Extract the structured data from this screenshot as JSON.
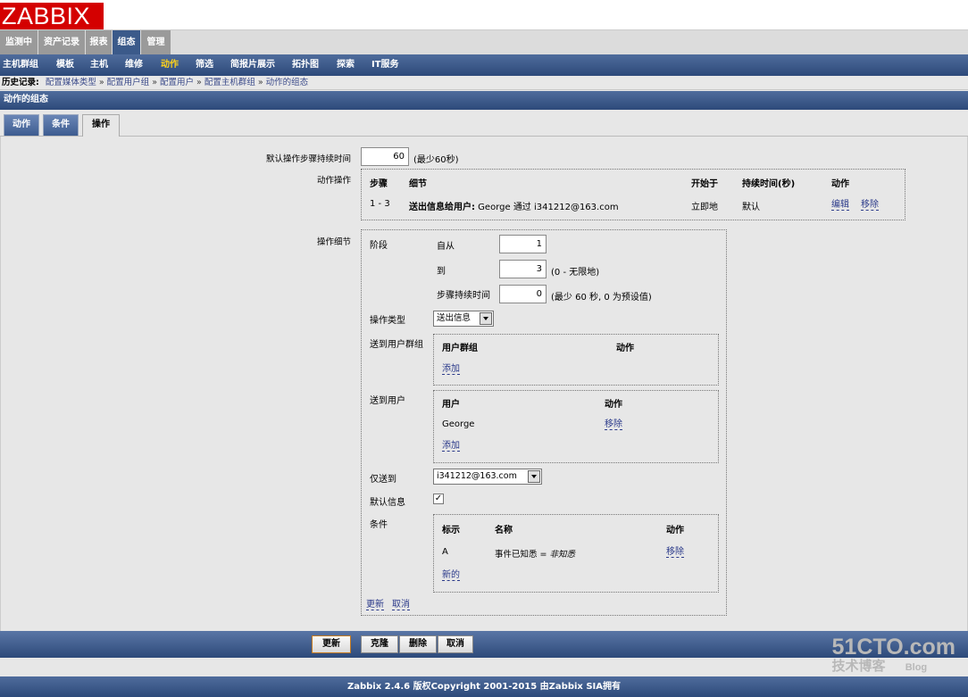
{
  "logo": "ZABBIX",
  "main_menu": [
    "监测中",
    "资产记录",
    "报表",
    "组态",
    "管理"
  ],
  "main_menu_active": "组态",
  "sub_menu": [
    "主机群组",
    "模板",
    "主机",
    "维修",
    "动作",
    "筛选",
    "简报片展示",
    "拓扑图",
    "探索",
    "IT服务"
  ],
  "sub_menu_active": "动作",
  "history": {
    "label": "历史记录:",
    "items": [
      "配置媒体类型",
      "配置用户组",
      "配置用户",
      "配置主机群组",
      "动作的组态"
    ],
    "separator": "»"
  },
  "page_title": "动作的组态",
  "tabs": [
    "动作",
    "条件",
    "操作"
  ],
  "active_tab": "操作",
  "form": {
    "default_step_duration_label": "默认操作步骤持续时间",
    "default_step_duration_value": "60",
    "default_step_duration_hint": "(最少60秒)",
    "operations_label": "动作操作",
    "operations_table": {
      "headers": [
        "步骤",
        "细节",
        "开始于",
        "持续时间(秒)",
        "动作"
      ],
      "rows": [
        {
          "steps": "1 - 3",
          "detail_bold": "送出信息给用户:",
          "detail_rest": " George 通过 i341212@163.com",
          "start": "立即地",
          "duration": "默认",
          "edit": "编辑",
          "remove": "移除"
        }
      ]
    },
    "op_details_label": "操作细节",
    "step_label": "阶段",
    "from_label": "自从",
    "from_value": "1",
    "to_label": "到",
    "to_value": "3",
    "to_hint": "(0 - 无限地)",
    "step_duration_label": "步骤持续时间",
    "step_duration_value": "0",
    "step_duration_hint": "(最少 60 秒, 0 为预设值)",
    "op_type_label": "操作类型",
    "op_type_value": "送出信息",
    "send_groups_label": "送到用户群组",
    "groups_table": {
      "headers": [
        "用户群组",
        "动作"
      ],
      "add": "添加"
    },
    "send_users_label": "送到用户",
    "users_table": {
      "headers": [
        "用户",
        "动作"
      ],
      "rows": [
        {
          "user": "George",
          "remove": "移除"
        }
      ],
      "add": "添加"
    },
    "send_only_label": "仅送到",
    "send_only_value": "i341212@163.com",
    "default_message_label": "默认信息",
    "default_message_checked": "✓",
    "conditions_label": "条件",
    "conditions_table": {
      "headers": [
        "标示",
        "名称",
        "动作"
      ],
      "rows": [
        {
          "label": "A",
          "name": "事件已知悉 = ",
          "name_value": "非知悉",
          "remove": "移除"
        }
      ],
      "new": "新的"
    },
    "update_link": "更新",
    "cancel_link": "取消"
  },
  "buttons": {
    "update": "更新",
    "clone": "克隆",
    "delete": "删除",
    "cancel": "取消"
  },
  "footer": "Zabbix 2.4.6 版权Copyright 2001-2015 由Zabbix SIA拥有",
  "watermark": {
    "site": "51CTO.com",
    "sub": "技术博客",
    "blog": "Blog"
  }
}
